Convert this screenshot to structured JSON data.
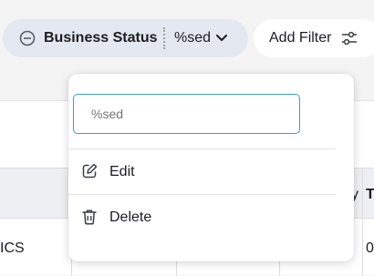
{
  "filters": {
    "status_chip": {
      "label": "Business Status",
      "value": "%sed",
      "remove_icon": "minus-circle-icon",
      "dropdown_icon": "chevron-down-icon"
    },
    "add_filter": {
      "label": "Add Filter",
      "icon": "sliders-icon"
    }
  },
  "table": {
    "header_partial": [
      "y",
      "T"
    ],
    "row_partial": [
      "ICS",
      "0"
    ]
  },
  "dropdown": {
    "search_placeholder": "%sed",
    "items": [
      {
        "label": "Edit",
        "icon": "edit-icon"
      },
      {
        "label": "Delete",
        "icon": "trash-icon"
      }
    ]
  }
}
